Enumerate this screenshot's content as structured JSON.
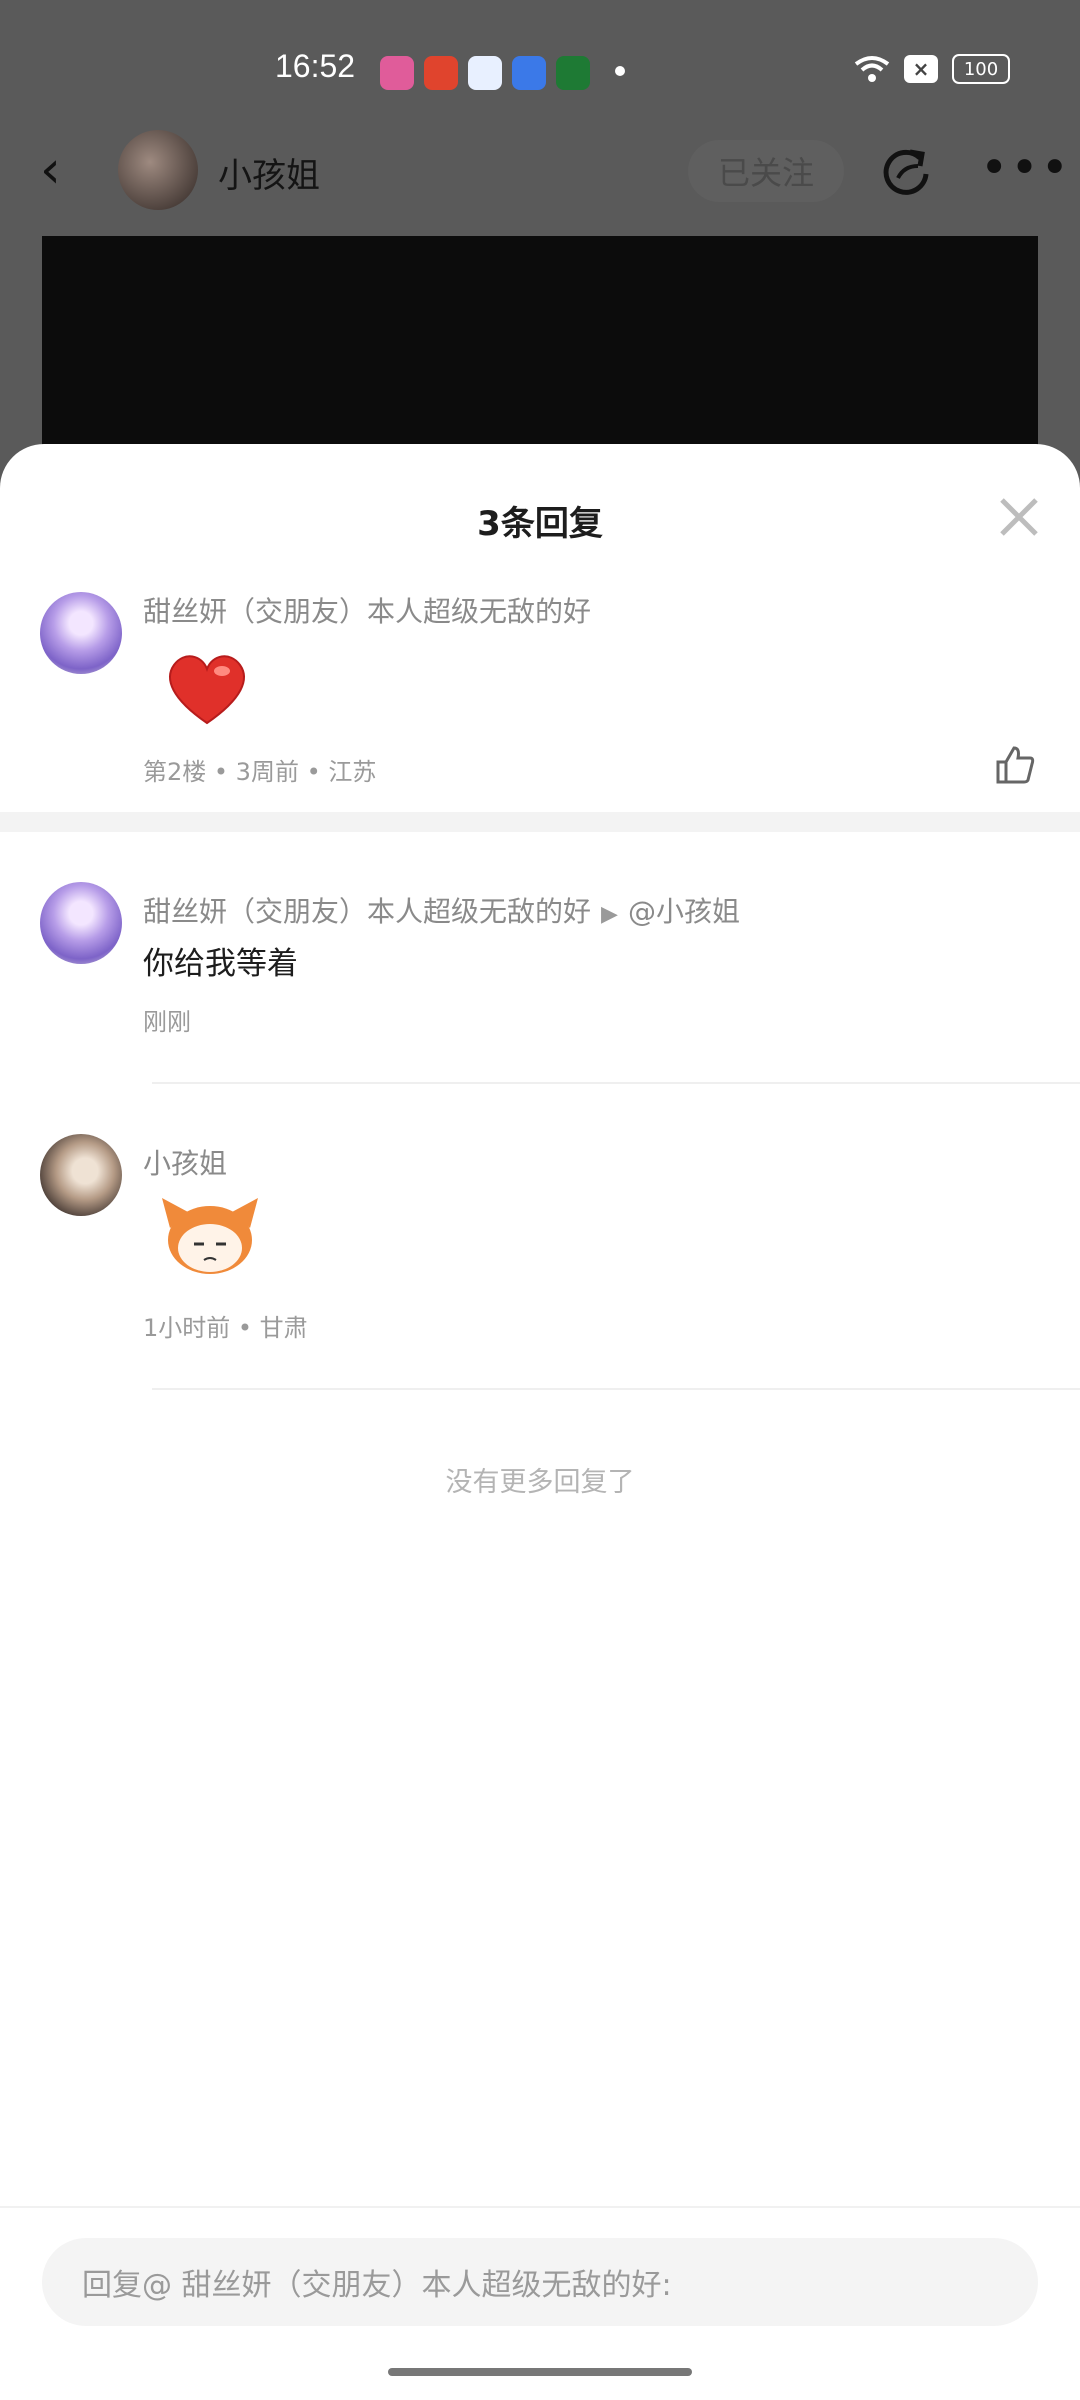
{
  "status": {
    "time": "16:52",
    "battery": "100"
  },
  "header": {
    "name": "小孩姐",
    "follow_label": "已关注"
  },
  "sheet": {
    "title": "3条回复",
    "comments": [
      {
        "name": "甜丝妍（交朋友）本人超级无敌的好",
        "meta": "第2楼 • 3周前 • 江苏"
      },
      {
        "name": "甜丝妍（交朋友）本人超级无敌的好",
        "reply_to": "@小孩姐",
        "text": "你给我等着",
        "meta": "刚刚"
      },
      {
        "name": "小孩姐",
        "meta": "1小时前 • 甘肃"
      }
    ],
    "end_text": "没有更多回复了",
    "reply_placeholder": "回复@ 甜丝妍（交朋友）本人超级无敌的好:"
  },
  "colors": {
    "accent": "#1d1d1d",
    "muted": "#9a9a9a"
  },
  "icons": [
    "back-icon",
    "share-icon",
    "more-icon",
    "close-icon",
    "thumbs-up-icon",
    "heart-emoji",
    "sticker-emoji"
  ]
}
